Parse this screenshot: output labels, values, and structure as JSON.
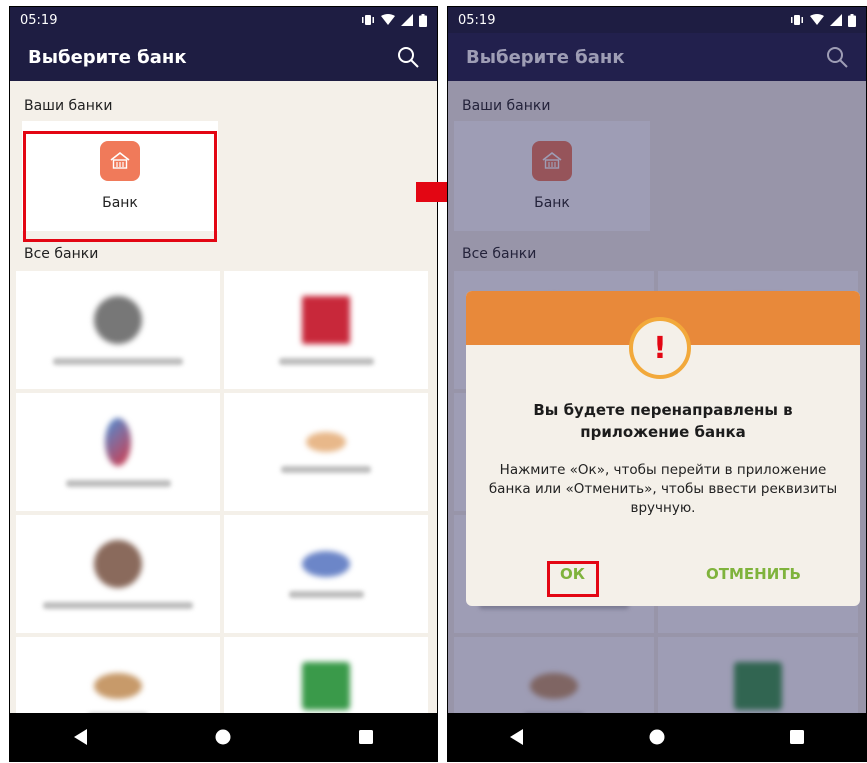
{
  "status": {
    "time": "05:19"
  },
  "appbar": {
    "title": "Выберите банк",
    "search_icon": "search-icon"
  },
  "sections": {
    "my_banks": "Ваши банки",
    "all_banks": "Все банки"
  },
  "my_bank": {
    "name": "Банк",
    "icon": "bank-building-icon",
    "logo_color": "#f07a5a"
  },
  "dialog": {
    "title": "Вы будете перенаправлены в приложение банка",
    "text": "Нажмите «Ок», чтобы перейти в приложение банка или «Отменить», чтобы ввести реквизиты вручную.",
    "ok": "ОК",
    "cancel": "ОТМЕНИТЬ",
    "header_color": "#e8893a",
    "accent_color": "#7fb33c"
  },
  "colors": {
    "appbar": "#1e1d42",
    "highlight": "#e30613",
    "background": "#f4f0e9"
  }
}
